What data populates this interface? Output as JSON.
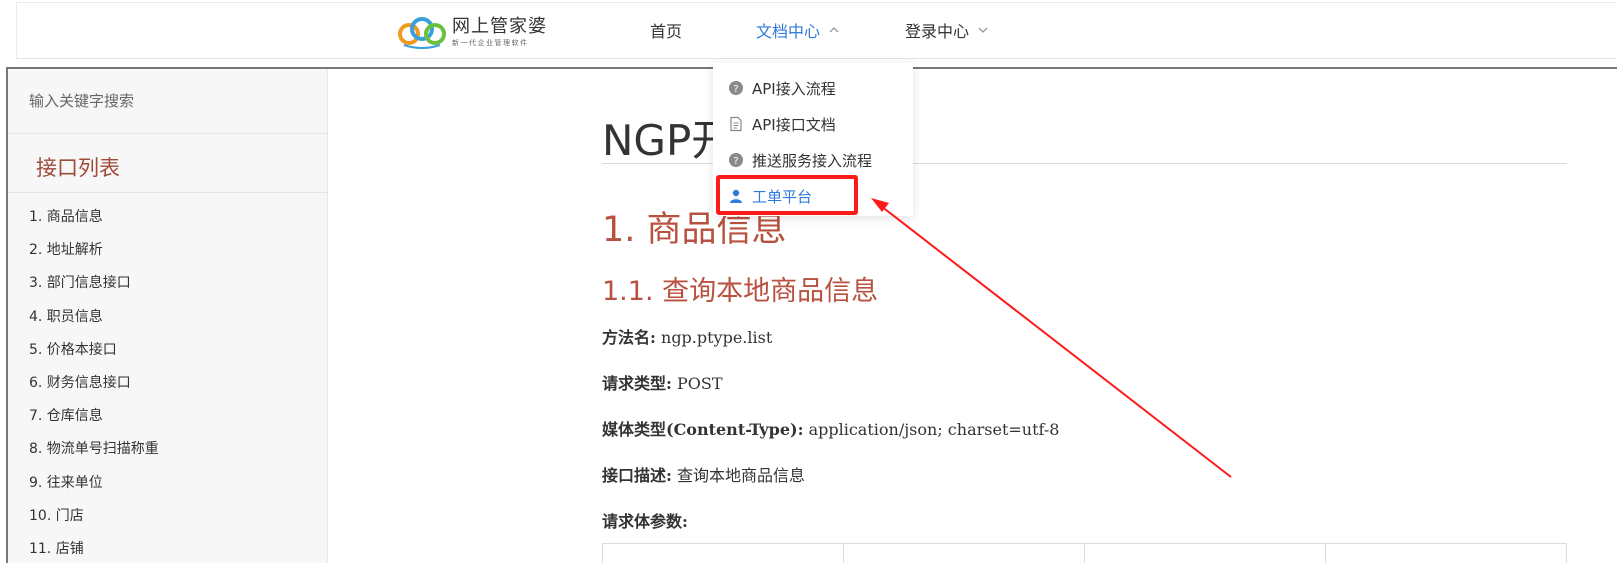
{
  "colors": {
    "accent": "#2f7bd9",
    "heading": "#b8513f",
    "annotation": "#ff1a1a",
    "sidebar_bg": "#f7f7f7"
  },
  "brand": {
    "title": "网上管家婆",
    "subtitle": "新一代企业管理软件"
  },
  "nav": {
    "home": "首页",
    "docs": "文档中心",
    "login": "登录中心"
  },
  "dropdown": {
    "items": [
      {
        "label": "API接入流程",
        "icon": "question-circle-icon"
      },
      {
        "label": "API接口文档",
        "icon": "document-icon"
      },
      {
        "label": "推送服务接入流程",
        "icon": "question-circle-icon"
      },
      {
        "label": "工单平台",
        "icon": "user-icon",
        "active": true
      }
    ]
  },
  "sidebar": {
    "search_placeholder": "输入关键字搜索",
    "section_title": "接口列表",
    "items": [
      "1. 商品信息",
      "2. 地址解析",
      "3. 部门信息接口",
      "4. 职员信息",
      "5. 价格本接口",
      "6. 财务信息接口",
      "7. 仓库信息",
      "8. 物流单号扫描称重",
      "9. 往来单位",
      "10. 门店",
      "11. 店铺"
    ]
  },
  "content": {
    "title": "NGP开",
    "h1": "1. 商品信息",
    "h2": "1.1. 查询本地商品信息",
    "fields": [
      {
        "key": "方法名:",
        "value": " ngp.ptype.list"
      },
      {
        "key": "请求类型:",
        "value": " POST"
      },
      {
        "key": "媒体类型(Content-Type):",
        "value": " application/json; charset=utf-8"
      },
      {
        "key": "接口描述:",
        "value": " 查询本地商品信息"
      },
      {
        "key": "请求体参数:",
        "value": ""
      }
    ]
  }
}
